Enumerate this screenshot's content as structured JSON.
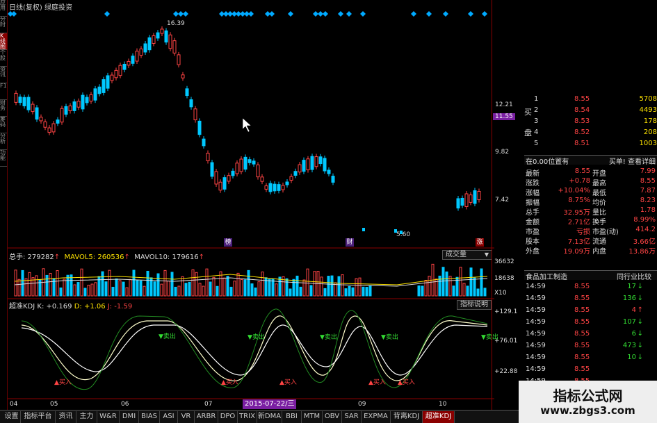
{
  "window": {
    "title": "日线(复权) 绿庭投资"
  },
  "left_sidebar": {
    "items": [
      "应用",
      "分时",
      "K线图",
      "个股",
      "资讯",
      "F10",
      "财务",
      "筹码",
      "分析",
      "功能"
    ],
    "active_index": 2
  },
  "price_panel": {
    "axis_labels": [
      "12.21",
      "11.55",
      "9.82",
      "7.42"
    ],
    "current_price_tag": "11.55",
    "high_annotation": "16.39",
    "low_annotation": "5.60",
    "markers": [
      "榜",
      "财",
      "涨"
    ]
  },
  "volume_panel": {
    "header": {
      "total_label": "总手: 279282",
      "ma5_label": "MAVOL5: 260536",
      "ma10_label": "MAVOL10: 179616"
    },
    "dropdown_label": "成交量",
    "axis_labels": [
      "36632",
      "18638",
      "X10"
    ]
  },
  "kdj_panel": {
    "header_label": "超准KDJ",
    "header_k": "K: +0.169",
    "header_d": "D: +1.06",
    "header_j": "J: -1.59",
    "help_button": "指标说明",
    "axis_labels": [
      "+129.1",
      "+76.01",
      "+22.88"
    ],
    "buy_labels": [
      "买入",
      "买入",
      "买入",
      "买入",
      "买入"
    ],
    "sell_labels": [
      "卖出",
      "卖出",
      "卖出",
      "卖出",
      "卖出"
    ]
  },
  "x_axis": {
    "labels": [
      "04",
      "05",
      "06",
      "07",
      "09",
      "10"
    ],
    "cursor_date": "2015-07-22/三"
  },
  "order_book": {
    "side_label_buy": "买",
    "side_label_pan": "盘",
    "rows": [
      {
        "level": "1",
        "price": "8.55",
        "vol": "5708"
      },
      {
        "level": "2",
        "price": "8.54",
        "vol": "4493"
      },
      {
        "level": "3",
        "price": "8.53",
        "vol": "178"
      },
      {
        "level": "4",
        "price": "8.52",
        "vol": "208"
      },
      {
        "level": "5",
        "price": "8.51",
        "vol": "1003"
      }
    ]
  },
  "position_bar": {
    "left": "在0.00位置有",
    "right": "买单! 查看详细"
  },
  "quote": [
    {
      "l1": "最新",
      "v1": "8.55",
      "l2": "开盘",
      "v2": "7.99"
    },
    {
      "l1": "涨跌",
      "v1": "+0.78",
      "l2": "最高",
      "v2": "8.55"
    },
    {
      "l1": "涨幅",
      "v1": "+10.04%",
      "l2": "最低",
      "v2": "7.87"
    },
    {
      "l1": "振幅",
      "v1": "8.75%",
      "l2": "均价",
      "v2": "8.23"
    },
    {
      "l1": "总手",
      "v1": "32.95万",
      "l2": "量比",
      "v2": "1.78"
    },
    {
      "l1": "金额",
      "v1": "2.71亿",
      "l2": "换手",
      "v2": "8.99%"
    },
    {
      "l1": "市盈",
      "v1": "亏损",
      "l2": "市盈(动)",
      "v2": "414.2"
    },
    {
      "l1": "股本",
      "v1": "7.13亿",
      "l2": "流通",
      "v2": "3.66亿"
    },
    {
      "l1": "外盘",
      "v1": "19.09万",
      "l2": "内盘",
      "v2": "13.86万"
    }
  ],
  "industry_bar": {
    "left": "食品加工制造",
    "right": "同行业比较"
  },
  "ticks": [
    {
      "time": "14:59",
      "price": "8.55",
      "vol": "17",
      "dir": "down"
    },
    {
      "time": "14:59",
      "price": "8.55",
      "vol": "136",
      "dir": "down"
    },
    {
      "time": "14:59",
      "price": "8.55",
      "vol": "4",
      "dir": "up"
    },
    {
      "time": "14:59",
      "price": "8.55",
      "vol": "107",
      "dir": "down"
    },
    {
      "time": "14:59",
      "price": "8.55",
      "vol": "6",
      "dir": "down"
    },
    {
      "time": "14:59",
      "price": "8.55",
      "vol": "473",
      "dir": "down"
    },
    {
      "time": "14:59",
      "price": "8.55",
      "vol": "10",
      "dir": "down"
    },
    {
      "time": "14:59",
      "price": "8.55",
      "vol": "",
      "dir": ""
    },
    {
      "time": "14:59",
      "price": "8.55",
      "vol": "",
      "dir": ""
    }
  ],
  "bottom_tabs": [
    "设置",
    "指标平台",
    "资讯",
    "主力",
    "W&R",
    "DMI",
    "BIAS",
    "ASI",
    "VR",
    "ARBR",
    "DPO",
    "TRIX",
    "新DMA",
    "BBI",
    "MTM",
    "OBV",
    "SAR",
    "EXPMA",
    "背离KDJ",
    "超准KDJ"
  ],
  "bottom_tabs_active": 19,
  "watermark": {
    "line1": "指标公式网",
    "line2": "www.zbgs3.com"
  },
  "colors": {
    "up": "#ff4444",
    "down": "#00c8ff",
    "accent": "#8b0000",
    "yellow": "#ffe400",
    "green": "#33dd33"
  }
}
